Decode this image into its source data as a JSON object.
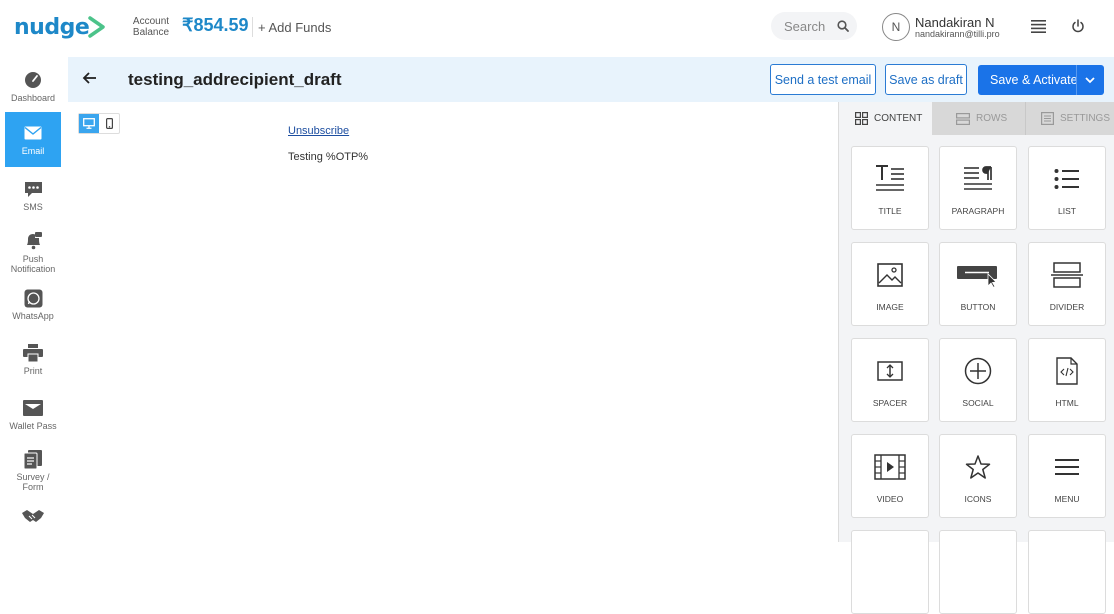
{
  "app": {
    "logo_text": "nudge",
    "account_balance_label_1": "Account",
    "account_balance_label_2": "Balance",
    "account_balance_value": "₹854.59",
    "add_funds_label": "+ Add Funds",
    "search_label": "Search",
    "user": {
      "initial": "N",
      "name": "Nandakiran N",
      "email": "nandakirann@tilli.pro"
    },
    "accent": "#1e88c8",
    "primary": "#1a73e8"
  },
  "sidebar": {
    "items": [
      {
        "label": "Dashboard",
        "icon": "gauge-icon"
      },
      {
        "label": "Email",
        "icon": "envelope-icon",
        "active": true
      },
      {
        "label": "SMS",
        "icon": "chat-bubble-icon"
      },
      {
        "label_1": "Push",
        "label_2": "Notification",
        "icon": "bell-icon"
      },
      {
        "label": "WhatsApp",
        "icon": "whatsapp-icon"
      },
      {
        "label": "Print",
        "icon": "printer-icon"
      },
      {
        "label": "Wallet Pass",
        "icon": "wallet-icon"
      },
      {
        "label_1": "Survey /",
        "label_2": "Form",
        "icon": "form-icon"
      },
      {
        "label": "",
        "icon": "handshake-icon"
      }
    ]
  },
  "header": {
    "title": "testing_addrecipient_draft",
    "send_test_label": "Send a test email",
    "save_draft_label": "Save as draft",
    "save_activate_label": "Save & Activate"
  },
  "canvas": {
    "unsubscribe_text": "Unsubscribe",
    "body_text": "Testing %OTP%"
  },
  "panel": {
    "tabs": [
      {
        "label": "CONTENT",
        "active": true
      },
      {
        "label": "ROWS"
      },
      {
        "label": "SETTINGS"
      }
    ],
    "blocks": [
      {
        "label": "TITLE",
        "icon": "title-icon"
      },
      {
        "label": "PARAGRAPH",
        "icon": "paragraph-icon"
      },
      {
        "label": "LIST",
        "icon": "list-icon"
      },
      {
        "label": "IMAGE",
        "icon": "image-icon"
      },
      {
        "label": "BUTTON",
        "icon": "button-icon"
      },
      {
        "label": "DIVIDER",
        "icon": "divider-icon"
      },
      {
        "label": "SPACER",
        "icon": "spacer-icon"
      },
      {
        "label": "SOCIAL",
        "icon": "social-icon"
      },
      {
        "label": "HTML",
        "icon": "html-icon"
      },
      {
        "label": "VIDEO",
        "icon": "video-icon"
      },
      {
        "label": "ICONS",
        "icon": "star-icon"
      },
      {
        "label": "MENU",
        "icon": "menu-icon"
      }
    ]
  }
}
